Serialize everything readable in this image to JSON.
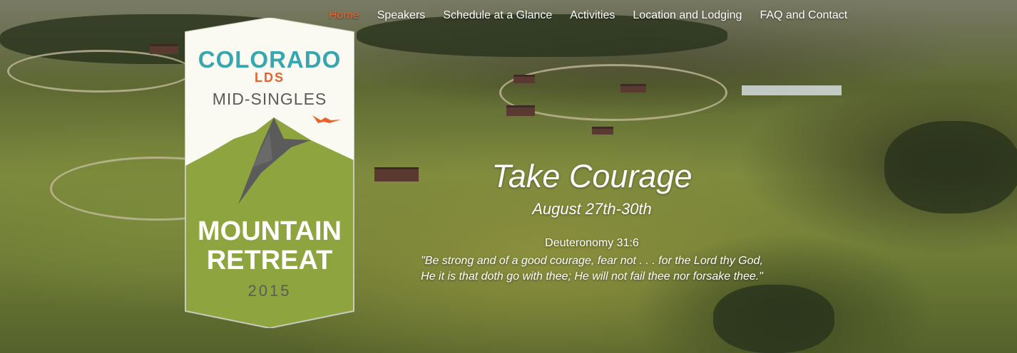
{
  "nav": {
    "items": [
      {
        "label": "Home",
        "active": true
      },
      {
        "label": "Speakers",
        "active": false
      },
      {
        "label": "Schedule at a Glance",
        "active": false
      },
      {
        "label": "Activities",
        "active": false
      },
      {
        "label": "Location and Lodging",
        "active": false
      },
      {
        "label": "FAQ and Contact",
        "active": false
      }
    ],
    "active_color": "#e8632c"
  },
  "logo": {
    "line1": "COLORADO",
    "line2": "LDS",
    "line3": "MID-SINGLES",
    "line4": "MOUNTAIN",
    "line5": "RETREAT",
    "year": "2015",
    "icons": [
      "bird-icon",
      "mountain-icon"
    ],
    "colors": {
      "teal": "#36a6b0",
      "orange": "#e8632c",
      "green": "#8da43f",
      "gray": "#5b5b5b",
      "cream": "#fbfaf2"
    }
  },
  "hero": {
    "title": "Take Courage",
    "dates": "August 27th-30th",
    "verse_ref": "Deuteronomy 31:6",
    "verse_line1": "\"Be strong and of a good courage, fear not . . . for the Lord thy God,",
    "verse_line2": "He it is that doth go with thee; He will not fail thee nor forsake thee.\""
  }
}
